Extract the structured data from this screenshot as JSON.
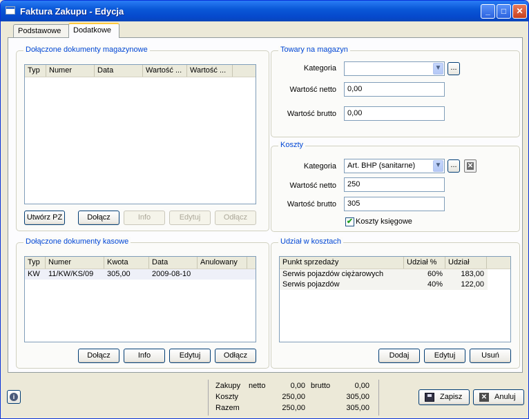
{
  "window": {
    "title": "Faktura Zakupu - Edycja",
    "minimize": "_",
    "maximize": "□",
    "close": "✕"
  },
  "tabs": [
    {
      "label": "Podstawowe"
    },
    {
      "label": "Dodatkowe"
    }
  ],
  "magazynowe": {
    "title": "Dołączone dokumenty magazynowe",
    "columns": [
      "Typ",
      "Numer",
      "Data",
      "Wartość ...",
      "Wartość ..."
    ],
    "rows": [],
    "buttons": {
      "utworz": "Utwórz PZ",
      "dolacz": "Dołącz",
      "info": "Info",
      "edytuj": "Edytuj",
      "odlacz": "Odłącz"
    }
  },
  "towary": {
    "title": "Towary na magazyn",
    "kategoria_label": "Kategoria",
    "kategoria_value": "",
    "netto_label": "Wartość netto",
    "netto_value": "0,00",
    "brutto_label": "Wartość brutto",
    "brutto_value": "0,00",
    "dots": "..."
  },
  "koszty": {
    "title": "Koszty",
    "kategoria_label": "Kategoria",
    "kategoria_value": "Art. BHP (sanitarne)",
    "netto_label": "Wartość netto",
    "netto_value": "250",
    "brutto_label": "Wartość brutto",
    "brutto_value": "305",
    "ksiegowe_label": "Koszty księgowe",
    "ksiegowe_checked": true,
    "dots": "..."
  },
  "kasowe": {
    "title": "Dołączone dokumenty kasowe",
    "columns": [
      "Typ",
      "Numer",
      "Kwota",
      "Data",
      "Anulowany"
    ],
    "rows": [
      {
        "typ": "KW",
        "numer": "11/KW/KS/09",
        "kwota": "305,00",
        "data": "2009-08-10",
        "anulowany": ""
      }
    ],
    "buttons": {
      "dolacz": "Dołącz",
      "info": "Info",
      "edytuj": "Edytuj",
      "odlacz": "Odłącz"
    }
  },
  "udzial": {
    "title": "Udział w kosztach",
    "columns": [
      "Punkt sprzedaży",
      "Udział %",
      "Udział"
    ],
    "rows": [
      {
        "punkt": "Serwis pojazdów ciężarowych",
        "procent": "60%",
        "udzial": "183,00"
      },
      {
        "punkt": "Serwis pojazdów",
        "procent": "40%",
        "udzial": "122,00"
      }
    ],
    "buttons": {
      "dodaj": "Dodaj",
      "edytuj": "Edytuj",
      "usun": "Usuń"
    }
  },
  "summary": {
    "zakupy": "Zakupy",
    "netto_label": "netto",
    "brutto_label": "brutto",
    "zakupy_netto": "0,00",
    "zakupy_brutto": "0,00",
    "koszty": "Koszty",
    "koszty_netto": "250,00",
    "koszty_brutto": "305,00",
    "razem": "Razem",
    "razem_netto": "250,00",
    "razem_brutto": "305,00"
  },
  "footer": {
    "zapisz": "Zapisz",
    "anuluj": "Anuluj"
  }
}
